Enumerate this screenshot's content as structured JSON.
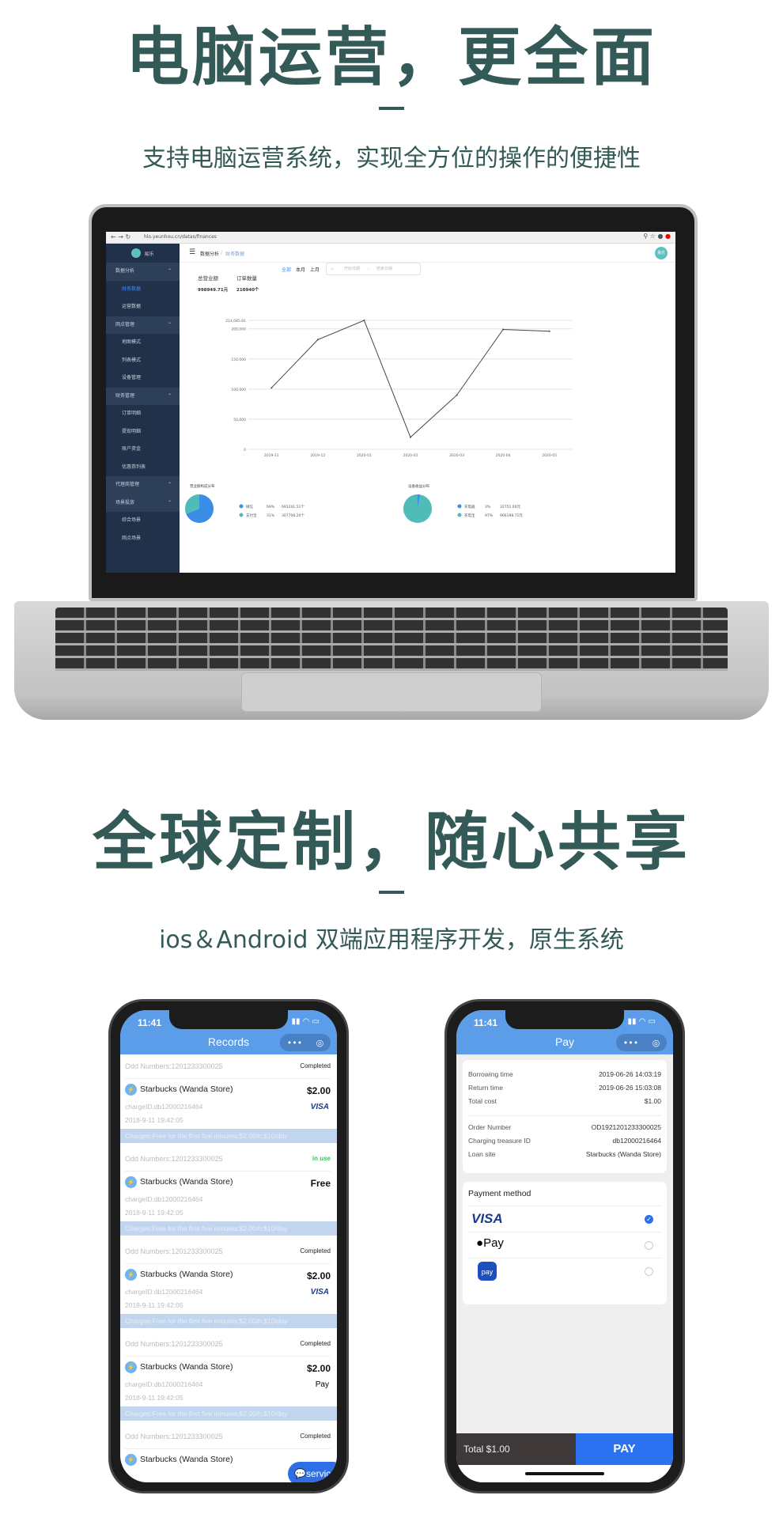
{
  "section1": {
    "title": "电脑运营，更全面",
    "subtitle": "支持电脑运营系统，实现全方位的操作的便捷性"
  },
  "laptop": {
    "url": "hlo.yeunhou.cn/datas/finances",
    "logo_text": "易乐",
    "avatar_text": "易乐",
    "breadcrumb": [
      "数据分析",
      "财务数据"
    ],
    "sidebar": [
      {
        "label": "数据分析",
        "type": "group"
      },
      {
        "label": "财务数据",
        "type": "selected"
      },
      {
        "label": "运营数据",
        "type": "item"
      },
      {
        "label": "网点管理",
        "type": "group"
      },
      {
        "label": "地图模式",
        "type": "item"
      },
      {
        "label": "列表模式",
        "type": "item"
      },
      {
        "label": "设备管理",
        "type": "item"
      },
      {
        "label": "财务管理",
        "type": "group"
      },
      {
        "label": "订单明细",
        "type": "item"
      },
      {
        "label": "提现明细",
        "type": "item"
      },
      {
        "label": "账户资金",
        "type": "item"
      },
      {
        "label": "优惠券列表",
        "type": "item"
      },
      {
        "label": "代理商管理",
        "type": "group"
      },
      {
        "label": "场景投放",
        "type": "group"
      },
      {
        "label": "综合场景",
        "type": "item"
      },
      {
        "label": "网点场景",
        "type": "item"
      }
    ],
    "filters": {
      "tabs": [
        "全部",
        "本月",
        "上月"
      ],
      "active": "全部",
      "start_placeholder": "开始日期",
      "end_placeholder": "结束日期"
    },
    "stats": [
      {
        "label": "总营业额",
        "value": "998949.71元"
      },
      {
        "label": "订单数量",
        "value": "210940个"
      }
    ],
    "chart": {
      "type": "line",
      "categories": [
        "2019-11",
        "2019-12",
        "2020-01",
        "2020-02",
        "2020-03",
        "2020-04",
        "2020-05"
      ],
      "values": [
        102000,
        182000,
        214085.81,
        20000,
        90000,
        199000,
        196000
      ],
      "yticks": [
        "0",
        "50,000",
        "100,000",
        "150,000",
        "200,000",
        "214,085.81"
      ],
      "ylim": [
        0,
        214085.81
      ],
      "grid": true,
      "line_color": "#444444"
    },
    "pies": [
      {
        "title": "营业额构成分布",
        "slices": [
          {
            "name": "微信",
            "pct": 69,
            "value": "691241.51个",
            "color": "#3a8ee6"
          },
          {
            "name": "支付宝",
            "pct": 31,
            "value": "307708.20个",
            "color": "#4fbcb8"
          }
        ]
      },
      {
        "title": "设备收益分布",
        "slices": [
          {
            "name": "充电器",
            "pct": 3,
            "value": "32751.00元",
            "color": "#3a8ee6"
          },
          {
            "name": "充电宝",
            "pct": 97,
            "value": "966198.71元",
            "color": "#4fbcb8"
          }
        ]
      }
    ]
  },
  "section2": {
    "title": "全球定制，随心共享",
    "subtitle": "ios＆Android 双端应用程序开发，原生系统"
  },
  "phone_records": {
    "time": "11:41",
    "title": "Records",
    "service_label": "service",
    "records": [
      {
        "odd": "Odd Numbers:1201233300025",
        "status": "Completed",
        "status_color": "#222222",
        "store": "Starbucks (Wanda Store)",
        "amount": "$2.00",
        "charge_id": "chargeID:db12000216464",
        "date": "2018-9-11 19:42:05",
        "pay": "VISA",
        "charges": "Charges:Free for the first five minutes;$2.00/h;$10/day"
      },
      {
        "odd": "Odd Numbers:1201233300025",
        "status": "in use",
        "status_color": "#3cc35f",
        "store": "Starbucks (Wanda Store)",
        "amount": "Free",
        "charge_id": "chargeID:db12000216464",
        "date": "2018-9-11 19:42:05",
        "pay": "",
        "charges": "Charges:Free for the first five minutes;$2.00/h;$10/day"
      },
      {
        "odd": "Odd Numbers:1201233300025",
        "status": "Completed",
        "status_color": "#222222",
        "store": "Starbucks (Wanda Store)",
        "amount": "$2.00",
        "charge_id": "chargeID:db12000216464",
        "date": "2018-9-11 19:42:05",
        "pay": "VISA",
        "charges": "Charges:Free for the first five minutes;$2.00/h;$10/day"
      },
      {
        "odd": "Odd Numbers:1201233300025",
        "status": "Completed",
        "status_color": "#222222",
        "store": "Starbucks (Wanda Store)",
        "amount": "$2.00",
        "charge_id": "chargeID:db12000216464",
        "date": "2018-9-11 19:42:05",
        "pay": " Pay",
        "charges": "Charges:Free for the first five minutes;$2.00/h;$10/day"
      },
      {
        "odd": "Odd Numbers:1201233300025",
        "status": "Completed",
        "status_color": "#222222",
        "store": "Starbucks (Wanda Store)",
        "amount": "",
        "charge_id": "",
        "date": "",
        "pay": "",
        "charges": ""
      }
    ]
  },
  "phone_pay": {
    "time": "11:41",
    "title": "Pay",
    "details1": [
      {
        "k": "Borrowing time",
        "v": "2019-06-26 14:03:19"
      },
      {
        "k": "Return time",
        "v": "2019-06-26 15:03:08"
      },
      {
        "k": "Total cost",
        "v": "$1.00"
      }
    ],
    "details2": [
      {
        "k": "Order Number",
        "v": "OD1921201233300025"
      },
      {
        "k": "Charging treasure ID",
        "v": "db12000216464"
      },
      {
        "k": "Loan site",
        "v": "Starbucks (Wanda Store)"
      }
    ],
    "payment_title": "Payment method",
    "methods": [
      {
        "name": "VISA",
        "selected": true
      },
      {
        "name": "Pay",
        "selected": false
      },
      {
        "name": "pay",
        "selected": false
      }
    ],
    "total": "Total  $1.00",
    "pay_button": "PAY"
  }
}
